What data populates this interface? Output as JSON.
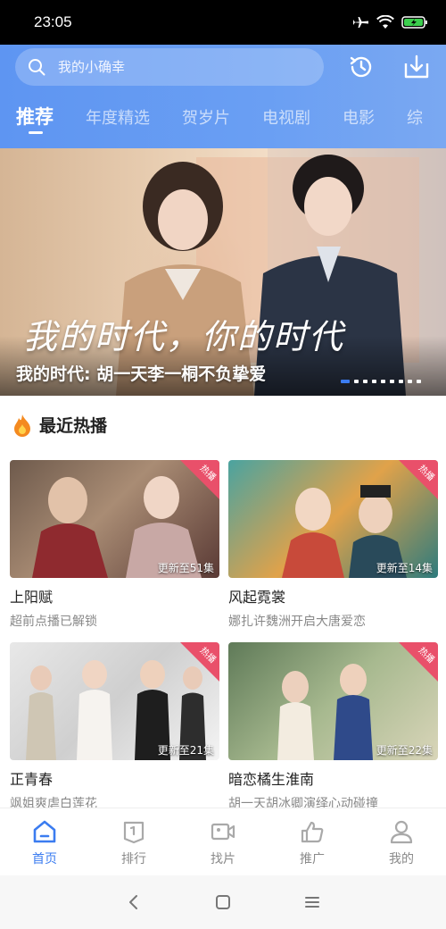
{
  "status_bar": {
    "time": "23:05"
  },
  "search": {
    "placeholder": "我的小确幸"
  },
  "tabs": [
    {
      "label": "推荐",
      "active": true
    },
    {
      "label": "年度精选"
    },
    {
      "label": "贺岁片"
    },
    {
      "label": "电视剧"
    },
    {
      "label": "电影"
    },
    {
      "label": "综"
    }
  ],
  "banner": {
    "art_text": "我的时代，你的时代",
    "title": "我的时代: 胡一天李一桐不负挚爱",
    "slide_count": 9,
    "active_slide": 1
  },
  "section": {
    "title": "最近热播"
  },
  "cards": [
    {
      "title": "上阳赋",
      "subtitle": "超前点播已解锁",
      "episodes": "更新至51集",
      "badge": "热播"
    },
    {
      "title": "风起霓裳",
      "subtitle": "娜扎许魏洲开启大唐爱恋",
      "episodes": "更新至14集",
      "badge": "热播"
    },
    {
      "title": "正青春",
      "subtitle": "飒姐爽虐白莲花",
      "episodes": "更新至21集",
      "badge": "热播"
    },
    {
      "title": "暗恋橘生淮南",
      "subtitle": "胡一天胡冰卿演绎心动碰撞",
      "episodes": "更新至22集",
      "badge": "热播"
    }
  ],
  "bottom_nav": [
    {
      "label": "首页",
      "icon": "home-icon",
      "active": true
    },
    {
      "label": "排行",
      "icon": "ranking-icon"
    },
    {
      "label": "找片",
      "icon": "video-camera-icon"
    },
    {
      "label": "推广",
      "icon": "thumbs-up-icon"
    },
    {
      "label": "我的",
      "icon": "user-icon"
    }
  ],
  "colors": {
    "accent": "#3b7cf0",
    "header": "#5e95f2",
    "badge": "#e9506a"
  }
}
